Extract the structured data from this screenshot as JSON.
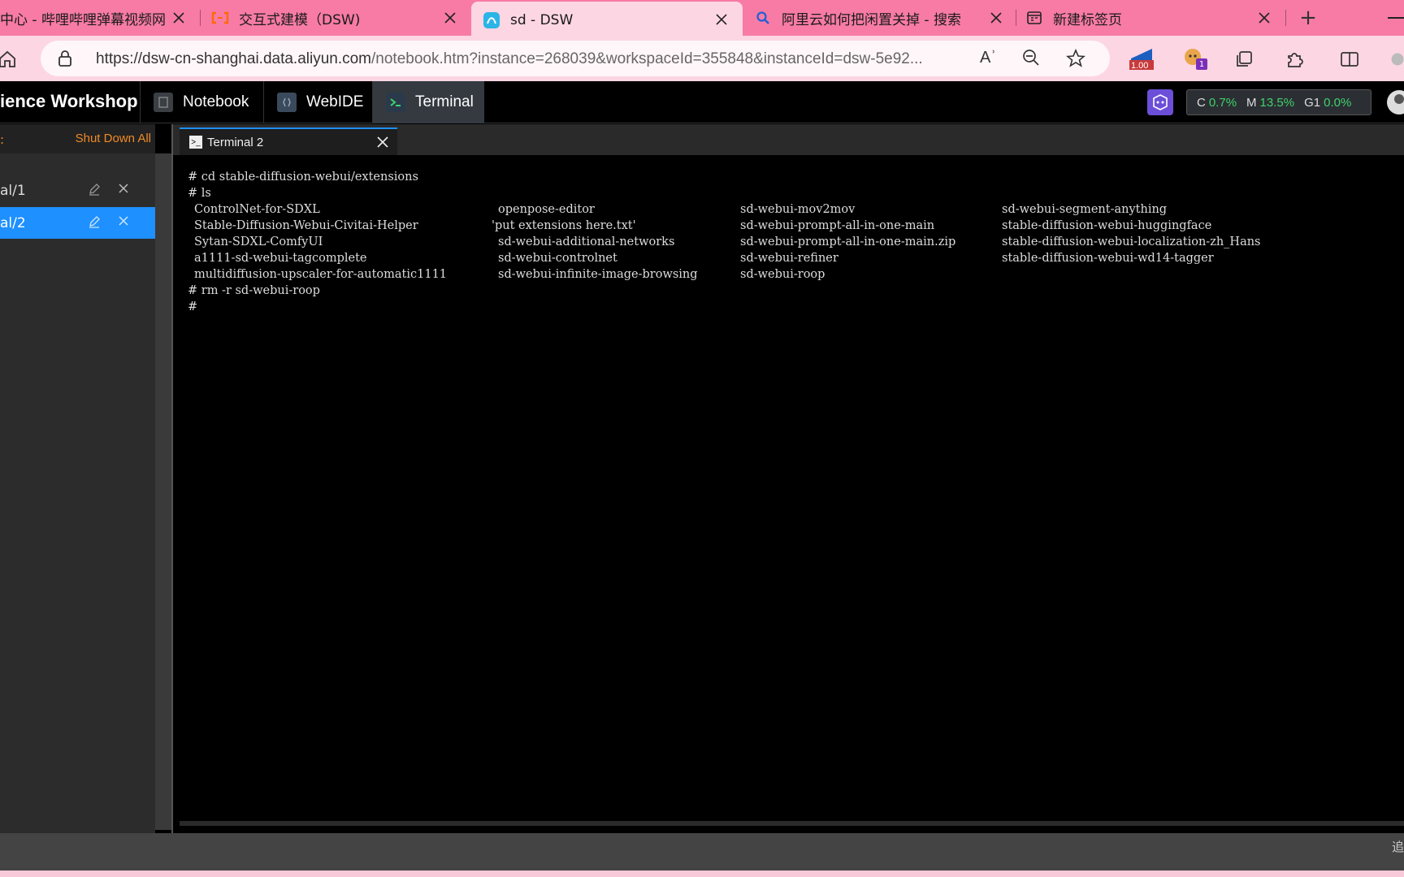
{
  "browser": {
    "tabs": [
      {
        "title": "中心 - 哔哩哔哩弹幕视频网",
        "icon": "bilibili-icon"
      },
      {
        "title": "交互式建模（DSW)",
        "icon": "aliyun-icon"
      },
      {
        "title": "sd - DSW",
        "icon": "dsw-icon",
        "active": true
      },
      {
        "title": "阿里云如何把闲置关掉 - 搜索",
        "icon": "search-icon"
      },
      {
        "title": "新建标签页",
        "icon": "newtab-icon"
      }
    ],
    "new_tab_symbol": "+",
    "url_host": "https://dsw-cn-shanghai.data.aliyun.com",
    "url_rest": "/notebook.htm?instance=268039&workspaceId=355848&instanceId=dsw-5e92...",
    "read_aloud_symbol": "Aʾ",
    "extension_badge_value": "1.00",
    "extension_badge_count": "1"
  },
  "app": {
    "brand": "ience Workshop",
    "tabs": [
      {
        "label": "Notebook"
      },
      {
        "label": "WebIDE"
      },
      {
        "label": "Terminal",
        "active": true
      }
    ],
    "resources": {
      "cpu_label": "C",
      "cpu_value": "0.7%",
      "mem_label": "M",
      "mem_value": "13.5%",
      "gpu_label": "G1",
      "gpu_value": "0.0%"
    }
  },
  "sidebar": {
    "shutdown_all": "Shut Down All",
    "items": [
      {
        "name": "al/1"
      },
      {
        "name": "al/2",
        "active": true
      }
    ]
  },
  "terminal": {
    "tab_title": "Terminal 2",
    "cmd1": "# cd stable-diffusion-webui/extensions",
    "cmd2": "# ls",
    "ls_rows": [
      [
        "ControlNet-for-SDXL",
        "openpose-editor",
        "sd-webui-mov2mov",
        "sd-webui-segment-anything"
      ],
      [
        "Stable-Diffusion-Webui-Civitai-Helper",
        "'put extensions here.txt'",
        "sd-webui-prompt-all-in-one-main",
        "stable-diffusion-webui-huggingface"
      ],
      [
        "Sytan-SDXL-ComfyUI",
        "sd-webui-additional-networks",
        "sd-webui-prompt-all-in-one-main.zip",
        "stable-diffusion-webui-localization-zh_Hans"
      ],
      [
        "a1111-sd-webui-tagcomplete",
        "sd-webui-controlnet",
        "sd-webui-refiner",
        "stable-diffusion-webui-wd14-tagger"
      ],
      [
        "multidiffusion-upscaler-for-automatic1111",
        "sd-webui-infinite-image-browsing",
        "sd-webui-roop",
        ""
      ]
    ],
    "cmd3": "# rm -r sd-webui-roop",
    "prompt": "#"
  },
  "statusbar": {
    "edge_glyph": "追"
  },
  "colors": {
    "tabstrip": "#f77ba5",
    "toolbar": "#fdd6e3",
    "accent_blue": "#1e90ff",
    "orange": "#f08a24",
    "resource_green": "#3fd26b"
  }
}
